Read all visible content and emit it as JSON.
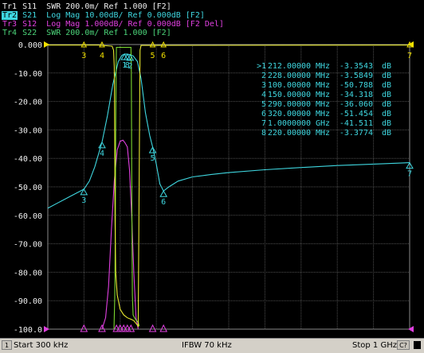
{
  "header": {
    "traces": [
      {
        "tag": "Tr1",
        "text": "S11  SWR 200.0m/ Ref 1.000 [F2]",
        "color": "#f0f0f0",
        "active": false
      },
      {
        "tag": "Tr2",
        "text": "S21  Log Mag 10.00dB/ Ref 0.000dB [F2]",
        "color": "#3fd7e0",
        "active": true
      },
      {
        "tag": "Tr3",
        "text": "S12  Log Mag 1.000dB/ Ref 0.000dB [F2 Del]",
        "color": "#e040e0",
        "active": false
      },
      {
        "tag": "Tr4",
        "text": "S22  SWR 200.0m/ Ref 1.000 [F2]",
        "color": "#4cd67a",
        "active": false
      }
    ]
  },
  "marker_table": {
    "rows": [
      {
        "id": ">1",
        "freq": "212.00000",
        "unit": "MHz",
        "value": "-3.3543",
        "vunit": "dB"
      },
      {
        "id": "2",
        "freq": "228.00000",
        "unit": "MHz",
        "value": "-3.5849",
        "vunit": "dB"
      },
      {
        "id": "3",
        "freq": "100.00000",
        "unit": "MHz",
        "value": "-50.788",
        "vunit": "dB"
      },
      {
        "id": "4",
        "freq": "150.00000",
        "unit": "MHz",
        "value": "-34.318",
        "vunit": "dB"
      },
      {
        "id": "5",
        "freq": "290.00000",
        "unit": "MHz",
        "value": "-36.060",
        "vunit": "dB"
      },
      {
        "id": "6",
        "freq": "320.00000",
        "unit": "MHz",
        "value": "-51.454",
        "vunit": "dB"
      },
      {
        "id": "7",
        "freq": "1.0000000",
        "unit": "GHz",
        "value": "-41.511",
        "vunit": "dB"
      },
      {
        "id": "8",
        "freq": "220.00000",
        "unit": "MHz",
        "value": "-3.3774",
        "vunit": "dB"
      }
    ]
  },
  "status": {
    "channel": "1",
    "start": "Start 300 kHz",
    "ifbw": "IFBW 70 kHz",
    "stop": "Stop 1 GHz",
    "cal": "C?"
  },
  "colors": {
    "s21": "#3fd7e0",
    "s12": "#e040e0",
    "s22": "#7ad630",
    "s11": "#e8e830",
    "grid": "#505050",
    "marker_yellow": "#f0e000",
    "axis_text": "#f0f0f0"
  },
  "chart_data": {
    "type": "line",
    "y_ticks": [
      "0.000",
      "-10.00",
      "-20.00",
      "-30.00",
      "-40.00",
      "-50.00",
      "-60.00",
      "-70.00",
      "-80.00",
      "-90.00",
      "-100.0"
    ],
    "ylim": [
      -100,
      0
    ],
    "x_unit": "MHz",
    "xlim": [
      0.3,
      1000
    ],
    "grid": true,
    "series": [
      {
        "trace": "Tr2",
        "color": "#3fd7e0",
        "points": [
          [
            0.3,
            -57.5
          ],
          [
            30,
            -55.5
          ],
          [
            60,
            -53.5
          ],
          [
            90,
            -51.5
          ],
          [
            100,
            -50.8
          ],
          [
            115,
            -48
          ],
          [
            130,
            -43
          ],
          [
            150,
            -34.3
          ],
          [
            165,
            -25
          ],
          [
            180,
            -14
          ],
          [
            195,
            -6
          ],
          [
            205,
            -3.8
          ],
          [
            212,
            -3.35
          ],
          [
            220,
            -3.38
          ],
          [
            228,
            -3.58
          ],
          [
            236,
            -4
          ],
          [
            248,
            -6
          ],
          [
            258,
            -12
          ],
          [
            270,
            -24
          ],
          [
            282,
            -32
          ],
          [
            290,
            -36.06
          ],
          [
            300,
            -42
          ],
          [
            310,
            -49
          ],
          [
            320,
            -51.45
          ],
          [
            335,
            -50
          ],
          [
            360,
            -48
          ],
          [
            400,
            -46.5
          ],
          [
            450,
            -45.7
          ],
          [
            500,
            -45
          ],
          [
            600,
            -44
          ],
          [
            700,
            -43.2
          ],
          [
            800,
            -42.5
          ],
          [
            900,
            -42
          ],
          [
            1000,
            -41.5
          ]
        ]
      },
      {
        "trace": "Tr3",
        "color": "#e040e0",
        "points": [
          [
            150,
            -100
          ],
          [
            160,
            -96
          ],
          [
            168,
            -85
          ],
          [
            176,
            -65
          ],
          [
            184,
            -48
          ],
          [
            192,
            -37
          ],
          [
            200,
            -34
          ],
          [
            208,
            -33.6
          ],
          [
            214,
            -34.6
          ],
          [
            220,
            -36
          ],
          [
            226,
            -44
          ],
          [
            232,
            -60
          ],
          [
            238,
            -80
          ],
          [
            244,
            -96
          ],
          [
            250,
            -100
          ]
        ]
      },
      {
        "trace": "Tr4",
        "color": "#7ad630",
        "points": [
          [
            183,
            -100
          ],
          [
            185,
            -90
          ],
          [
            186,
            -80
          ],
          [
            187,
            -60
          ],
          [
            188,
            -30
          ],
          [
            189,
            -8
          ],
          [
            190,
            -1
          ],
          [
            230,
            -1
          ],
          [
            231,
            -10
          ],
          [
            232,
            -40
          ],
          [
            233,
            -70
          ],
          [
            234,
            -88
          ],
          [
            236,
            -95
          ],
          [
            240,
            -96
          ],
          [
            245,
            -97
          ],
          [
            250,
            -97.5
          ],
          [
            253,
            -99
          ]
        ]
      },
      {
        "trace": "Tr1",
        "color": "#e8e830",
        "points": [
          [
            0.3,
            -0.2
          ],
          [
            140,
            -0.2
          ],
          [
            178,
            -0.6
          ],
          [
            182,
            -2
          ],
          [
            184,
            -8
          ],
          [
            185,
            -30
          ],
          [
            186,
            -60
          ],
          [
            188,
            -80
          ],
          [
            192,
            -88
          ],
          [
            200,
            -93
          ],
          [
            210,
            -95
          ],
          [
            220,
            -96
          ],
          [
            230,
            -96.5
          ],
          [
            238,
            -97
          ],
          [
            244,
            -98
          ],
          [
            250,
            -99
          ],
          [
            255,
            -2
          ],
          [
            258,
            -0.3
          ],
          [
            1000,
            -0.2
          ]
        ]
      }
    ],
    "markers": [
      {
        "id": "1",
        "x": 212,
        "y": -3.35
      },
      {
        "id": "2",
        "x": 228,
        "y": -3.58
      },
      {
        "id": "3",
        "x": 100,
        "y": -50.79
      },
      {
        "id": "4",
        "x": 150,
        "y": -34.32
      },
      {
        "id": "5",
        "x": 290,
        "y": -36.06
      },
      {
        "id": "6",
        "x": 320,
        "y": -51.45
      },
      {
        "id": "7",
        "x": 1000,
        "y": -41.51
      },
      {
        "id": "8",
        "x": 220,
        "y": -3.38
      }
    ],
    "top_markers": [
      {
        "id": "3",
        "x": 100
      },
      {
        "id": "4",
        "x": 150
      },
      {
        "id": "5",
        "x": 290
      },
      {
        "id": "6",
        "x": 320
      },
      {
        "id": "7",
        "x": 1000
      }
    ]
  }
}
